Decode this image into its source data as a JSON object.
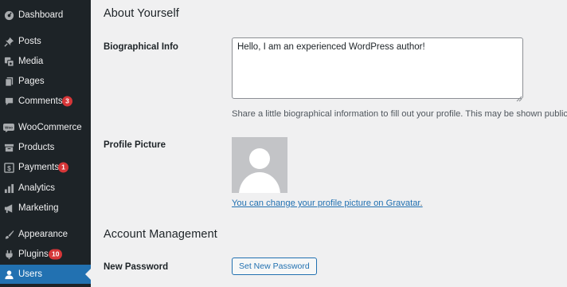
{
  "sidebar": {
    "items": [
      {
        "label": "Dashboard",
        "icon": "dashboard-icon"
      },
      {
        "label": "Posts",
        "icon": "pin-icon"
      },
      {
        "label": "Media",
        "icon": "media-icon"
      },
      {
        "label": "Pages",
        "icon": "pages-icon"
      },
      {
        "label": "Comments",
        "icon": "comment-icon",
        "badge": "3"
      },
      {
        "label": "WooCommerce",
        "icon": "woocommerce-icon"
      },
      {
        "label": "Products",
        "icon": "archive-icon"
      },
      {
        "label": "Payments",
        "icon": "dollar-icon",
        "badge": "1"
      },
      {
        "label": "Analytics",
        "icon": "bar-chart-icon"
      },
      {
        "label": "Marketing",
        "icon": "megaphone-icon"
      },
      {
        "label": "Appearance",
        "icon": "paintbrush-icon"
      },
      {
        "label": "Plugins",
        "icon": "plug-icon",
        "badge": "10"
      },
      {
        "label": "Users",
        "icon": "user-icon",
        "active": true
      }
    ]
  },
  "main": {
    "about_heading": "About Yourself",
    "bio_label": "Biographical Info",
    "bio_value": "Hello, I am an experienced WordPress author!",
    "bio_description": "Share a little biographical information to fill out your profile. This may be shown publicly.",
    "picture_label": "Profile Picture",
    "gravatar_link": "You can change your profile picture on Gravatar",
    "gravatar_period": ".",
    "account_heading": "Account Management",
    "password_label": "New Password",
    "set_password_button": "Set New Password"
  },
  "colors": {
    "sidebar_bg": "#1d2327",
    "active_item": "#2271b1",
    "badge": "#d63638",
    "link": "#2271b1",
    "content_bg": "#f0f0f1"
  }
}
